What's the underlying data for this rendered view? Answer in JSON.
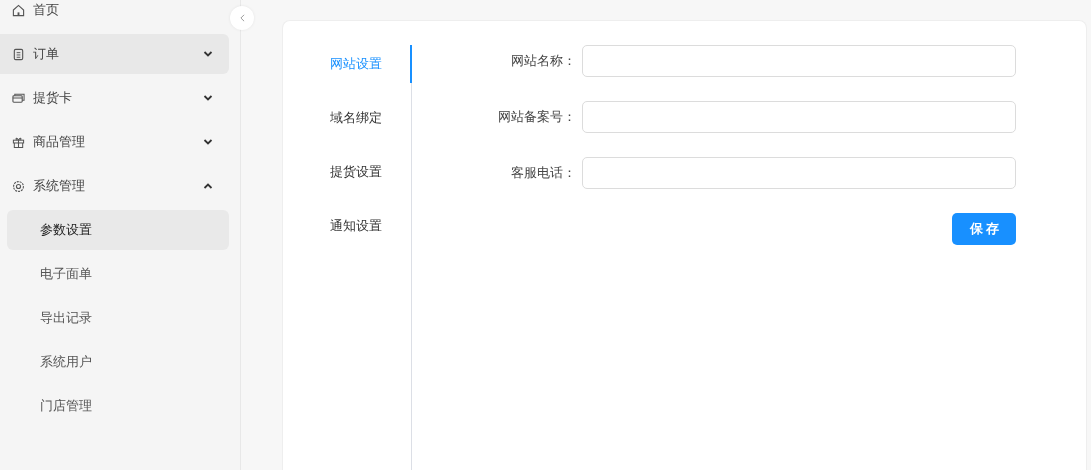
{
  "sidebar": {
    "items": [
      {
        "label": "首页",
        "hovered": false
      },
      {
        "label": "订单",
        "hovered": true,
        "expanded": false
      },
      {
        "label": "提货卡",
        "hovered": false,
        "expanded": false
      },
      {
        "label": "商品管理",
        "hovered": false,
        "expanded": false
      },
      {
        "label": "系统管理",
        "hovered": false,
        "expanded": true,
        "children": [
          {
            "label": "参数设置",
            "selected": true
          },
          {
            "label": "电子面单",
            "selected": false
          },
          {
            "label": "导出记录",
            "selected": false
          },
          {
            "label": "系统用户",
            "selected": false
          },
          {
            "label": "门店管理",
            "selected": false
          }
        ]
      }
    ]
  },
  "tabs": [
    {
      "label": "网站设置",
      "selected": true
    },
    {
      "label": "域名绑定",
      "selected": false
    },
    {
      "label": "提货设置",
      "selected": false
    },
    {
      "label": "通知设置",
      "selected": false
    }
  ],
  "form": {
    "fields": [
      {
        "label": "网站名称："
      },
      {
        "label": "网站备案号："
      },
      {
        "label": "客服电话："
      }
    ],
    "save_button": "保存"
  }
}
